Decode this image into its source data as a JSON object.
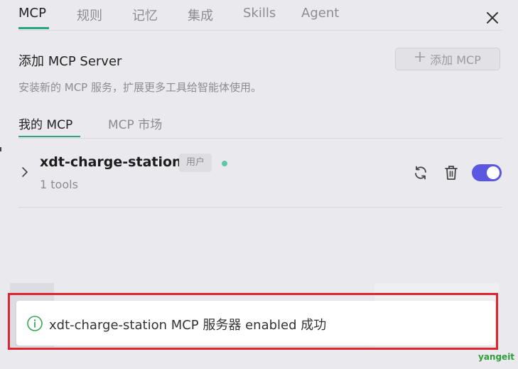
{
  "top_tabs": [
    {
      "label": "MCP",
      "active": true
    },
    {
      "label": "规则",
      "active": false
    },
    {
      "label": "记忆",
      "active": false
    },
    {
      "label": "集成",
      "active": false
    },
    {
      "label": "Skills",
      "active": false
    },
    {
      "label": "Agent",
      "active": false
    }
  ],
  "close_icon": "close-icon",
  "add_section": {
    "title": "添加 MCP Server",
    "description": "安装新的 MCP 服务，扩展更多工具给智能体使用。",
    "button_icon": "plus-icon",
    "button_label": "添加 MCP"
  },
  "sub_tabs": [
    {
      "label": "我的 MCP",
      "active": true
    },
    {
      "label": "MCP 市场",
      "active": false
    }
  ],
  "servers": [
    {
      "name": "xdt-charge-station",
      "badge": "用户",
      "status_color": "#5cc9a2",
      "tools": "1 tools",
      "enabled": true
    }
  ],
  "toast": {
    "icon": "info-icon",
    "message": "xdt-charge-station MCP 服务器 enabled 成功"
  },
  "watermark": "yangeit",
  "colors": {
    "accent_green": "#2ba57f",
    "toggle_on": "#5b57e0",
    "highlight_red": "#e0232d"
  }
}
